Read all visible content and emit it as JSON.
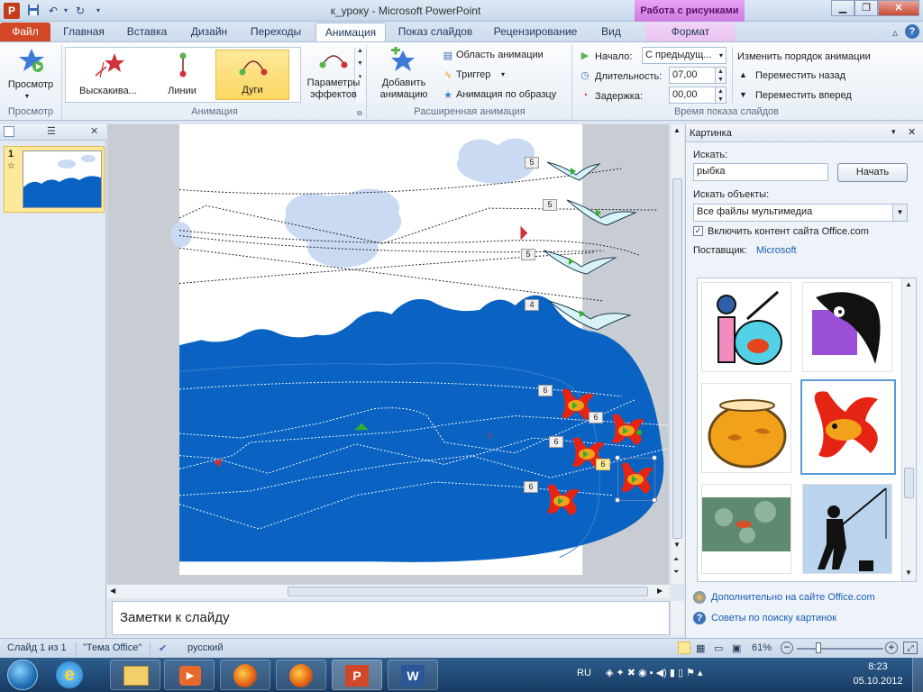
{
  "titlebar": {
    "title": "к_уроку - Microsoft PowerPoint",
    "context_group": "Работа с рисунками",
    "app_icon_letter": "P"
  },
  "tabs": [
    {
      "label": "Файл"
    },
    {
      "label": "Главная"
    },
    {
      "label": "Вставка"
    },
    {
      "label": "Дизайн"
    },
    {
      "label": "Переходы"
    },
    {
      "label": "Анимация"
    },
    {
      "label": "Показ слайдов"
    },
    {
      "label": "Рецензирование"
    },
    {
      "label": "Вид"
    },
    {
      "label": "Формат"
    }
  ],
  "ribbon": {
    "preview": {
      "label": "Просмотр",
      "group": "Просмотр"
    },
    "animation_gallery": {
      "items": [
        {
          "label": "Выскакива..."
        },
        {
          "label": "Линии"
        },
        {
          "label": "Дуги"
        }
      ],
      "effect_params": "Параметры эффектов",
      "group": "Анимация"
    },
    "advanced": {
      "add_animation": "Добавить анимацию",
      "animation_pane": "Область анимации",
      "trigger": "Триггер",
      "animation_painter": "Анимация по образцу",
      "group": "Расширенная анимация"
    },
    "timing": {
      "start_label": "Начало:",
      "start_value": "С предыдущ...",
      "duration_label": "Длительность:",
      "duration_value": "07,00",
      "delay_label": "Задержка:",
      "delay_value": "00,00",
      "reorder_label": "Изменить порядок анимации",
      "move_earlier": "Переместить назад",
      "move_later": "Переместить вперед",
      "group": "Время показа слайдов"
    }
  },
  "slides_panel": {
    "slide_number": "1",
    "star": "☆"
  },
  "slide": {
    "sky_color": "#ffffff",
    "sea_color": "#0a63c2",
    "cloud_color": "#c9daf2",
    "bird_tags": [
      "5",
      "5",
      "5",
      "4"
    ],
    "fish_tags": [
      "6",
      "6",
      "6",
      "6",
      "6"
    ]
  },
  "notes": {
    "placeholder": "Заметки к слайду"
  },
  "taskpane": {
    "title": "Картинка",
    "search_label": "Искать:",
    "search_value": "рыбка",
    "go_button": "Начать",
    "results_label": "Искать объекты:",
    "results_value": "Все файлы мультимедиа",
    "include_office": "Включить контент сайта Office.com",
    "include_office_checked": true,
    "provider_label": "Поставщик:",
    "provider_value": "Microsoft",
    "more_link": "Дополнительно на сайте Office.com",
    "tips_link": "Советы по поиску картинок"
  },
  "statusbar": {
    "slide_info": "Слайд 1 из 1",
    "theme": "\"Тема Office\"",
    "language": "русский",
    "zoom": "61%"
  },
  "taskbar": {
    "lang": "RU",
    "time": "8:23",
    "date": "05.10.2012"
  }
}
